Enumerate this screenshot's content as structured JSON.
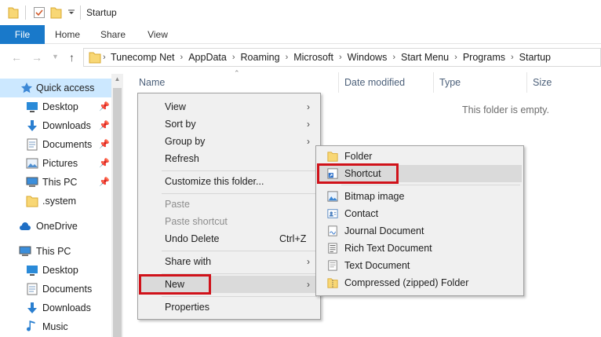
{
  "window": {
    "title": "Startup"
  },
  "ribbon": {
    "tabs": [
      "File",
      "Home",
      "Share",
      "View"
    ]
  },
  "address": {
    "crumbs": [
      "Tunecomp Net",
      "AppData",
      "Roaming",
      "Microsoft",
      "Windows",
      "Start Menu",
      "Programs",
      "Startup"
    ]
  },
  "nav": {
    "quick_access": "Quick access",
    "items": [
      {
        "label": "Desktop",
        "icon": "desktop-icon",
        "pinned": true
      },
      {
        "label": "Downloads",
        "icon": "downloads-icon",
        "pinned": true
      },
      {
        "label": "Documents",
        "icon": "documents-icon",
        "pinned": true
      },
      {
        "label": "Pictures",
        "icon": "pictures-icon",
        "pinned": true
      },
      {
        "label": "This PC",
        "icon": "computer-icon",
        "pinned": true
      },
      {
        "label": ".system",
        "icon": "folder-icon",
        "pinned": false
      }
    ],
    "onedrive": "OneDrive",
    "this_pc": "This PC",
    "pc_items": [
      {
        "label": "Desktop",
        "icon": "desktop-icon"
      },
      {
        "label": "Documents",
        "icon": "documents-icon"
      },
      {
        "label": "Downloads",
        "icon": "downloads-icon"
      },
      {
        "label": "Music",
        "icon": "music-icon"
      }
    ]
  },
  "columns": {
    "name": "Name",
    "date": "Date modified",
    "type": "Type",
    "size": "Size"
  },
  "empty_text": "This folder is empty.",
  "context_menu": {
    "view": "View",
    "sort_by": "Sort by",
    "group_by": "Group by",
    "refresh": "Refresh",
    "customize": "Customize this folder...",
    "paste": "Paste",
    "paste_shortcut": "Paste shortcut",
    "undo_delete": "Undo Delete",
    "undo_shortcut": "Ctrl+Z",
    "share_with": "Share with",
    "new": "New",
    "properties": "Properties"
  },
  "new_submenu": {
    "folder": "Folder",
    "shortcut": "Shortcut",
    "bitmap": "Bitmap image",
    "contact": "Contact",
    "journal": "Journal Document",
    "rtf": "Rich Text Document",
    "text": "Text Document",
    "zip": "Compressed (zipped) Folder"
  },
  "colors": {
    "accent": "#1979ca",
    "highlight_box": "#d0121a",
    "selection": "#cce8ff"
  }
}
